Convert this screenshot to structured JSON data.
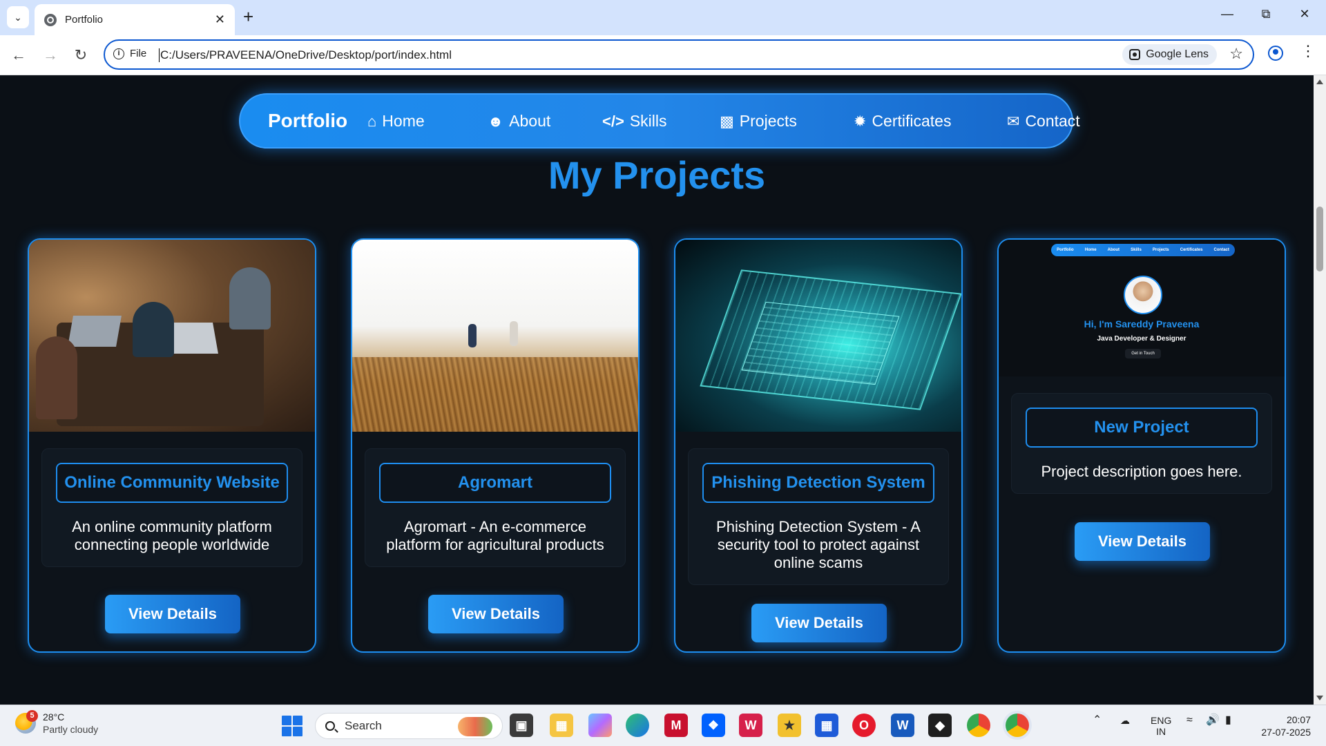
{
  "browser": {
    "tab_title": "Portfolio",
    "url_scheme_label": "File",
    "url": "C:/Users/PRAVEENA/OneDrive/Desktop/port/index.html",
    "lens_label": "Google Lens"
  },
  "page": {
    "brand": "Portfolio",
    "nav": [
      {
        "label": "Home",
        "icon": "home-icon"
      },
      {
        "label": "About",
        "icon": "user-icon"
      },
      {
        "label": "Skills",
        "icon": "code-icon"
      },
      {
        "label": "Projects",
        "icon": "sitemap-icon"
      },
      {
        "label": "Certificates",
        "icon": "certificate-icon"
      },
      {
        "label": "Contact",
        "icon": "envelope-icon"
      }
    ],
    "section_title": "My Projects",
    "projects": [
      {
        "title": "Online Community Website",
        "description": "An online community platform connecting people worldwide",
        "button": "View Details",
        "image": "team-working-on-laptops"
      },
      {
        "title": "Agromart",
        "description": "Agromart - An e-commerce platform for agricultural products",
        "button": "View Details",
        "image": "wheat-field"
      },
      {
        "title": "Phishing Detection System",
        "description": "Phishing Detection System - A security tool to protect against online scams",
        "button": "View Details",
        "image": "circuit-board"
      },
      {
        "title": "New Project",
        "description": "Project description goes here.",
        "button": "View Details",
        "image": "portfolio-screenshot"
      }
    ],
    "portfolio_preview": {
      "brand": "Portfolio",
      "nav": [
        "Home",
        "About",
        "Skills",
        "Projects",
        "Certificates",
        "Contact"
      ],
      "greeting": "Hi, I'm Sareddy Praveena",
      "role": "Java Developer & Designer",
      "cta": "Get in Touch"
    }
  },
  "taskbar": {
    "weather_temp": "28°C",
    "weather_desc": "Partly cloudy",
    "weather_badge": "5",
    "search_label": "Search",
    "language_top": "ENG",
    "language_bottom": "IN",
    "time": "20:07",
    "date": "27-07-2025"
  },
  "colors": {
    "accent": "#2391ee",
    "page_bg": "#0b1016",
    "nav_gradient_start": "#1a8cf0",
    "nav_gradient_end": "#1565c8"
  }
}
